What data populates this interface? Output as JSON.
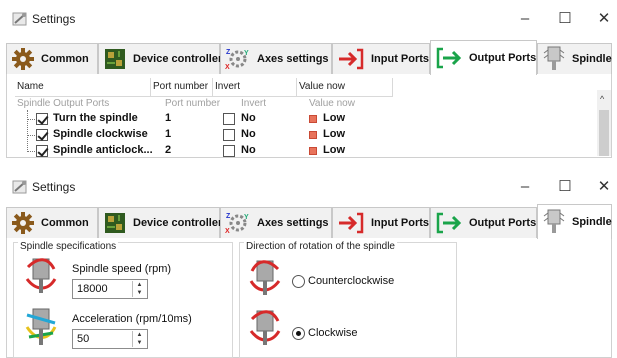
{
  "colors": {
    "accent_green": "#1aa44a",
    "accent_red": "#d62a2a",
    "led_low": "#e8735b",
    "tab_inactive_bg": "#f1f1f1"
  },
  "window_top": {
    "title": "Settings",
    "controls": {
      "minimize": "–",
      "maximize": "☐",
      "close": "✕"
    },
    "tabs": [
      {
        "label": "Common",
        "icon": "gear-icon"
      },
      {
        "label": "Device controller",
        "icon": "circuit-board-icon"
      },
      {
        "label": "Axes settings",
        "icon": "axes-gears-icon"
      },
      {
        "label": "Input Ports",
        "icon": "input-arrow-icon"
      },
      {
        "label": "Output Ports",
        "icon": "output-arrow-icon",
        "active": true
      },
      {
        "label": "Spindle",
        "icon": "spindle-icon"
      }
    ],
    "table": {
      "headers": [
        "Name",
        "Port number",
        "Invert",
        "Value now"
      ],
      "subheaders": [
        "Spindle Output Ports",
        "Port number",
        "Invert",
        "Value now"
      ],
      "rows": [
        {
          "name": "Turn the spindle",
          "checked": true,
          "port": "1",
          "invert_label": "No",
          "invert": false,
          "value": "Low"
        },
        {
          "name": "Spindle clockwise",
          "checked": true,
          "port": "1",
          "invert_label": "No",
          "invert": false,
          "value": "Low"
        },
        {
          "name": "Spindle anticlock...",
          "checked": true,
          "port": "2",
          "invert_label": "No",
          "invert": false,
          "value": "Low"
        }
      ],
      "scroll_up": "^"
    }
  },
  "window_bottom": {
    "title": "Settings",
    "controls": {
      "minimize": "–",
      "maximize": "☐",
      "close": "✕"
    },
    "tabs": [
      {
        "label": "Common",
        "icon": "gear-icon"
      },
      {
        "label": "Device controller",
        "icon": "circuit-board-icon"
      },
      {
        "label": "Axes settings",
        "icon": "axes-gears-icon"
      },
      {
        "label": "Input Ports",
        "icon": "input-arrow-icon"
      },
      {
        "label": "Output Ports",
        "icon": "output-arrow-icon"
      },
      {
        "label": "Spindle",
        "icon": "spindle-icon",
        "active": true
      }
    ],
    "spindle_specs": {
      "title": "Spindle specifications",
      "speed": {
        "label": "Spindle speed (rpm)",
        "value": "18000",
        "icon": "speed-spindle-icon"
      },
      "accel": {
        "label": "Acceleration (rpm/10ms)",
        "value": "50",
        "icon": "acceleration-spindle-icon"
      }
    },
    "direction": {
      "title": "Direction of rotation of the spindle",
      "options": [
        {
          "label": "Counterclockwise",
          "selected": false,
          "icon": "ccw-spindle-icon"
        },
        {
          "label": "Clockwise",
          "selected": true,
          "icon": "cw-spindle-icon"
        }
      ]
    }
  }
}
